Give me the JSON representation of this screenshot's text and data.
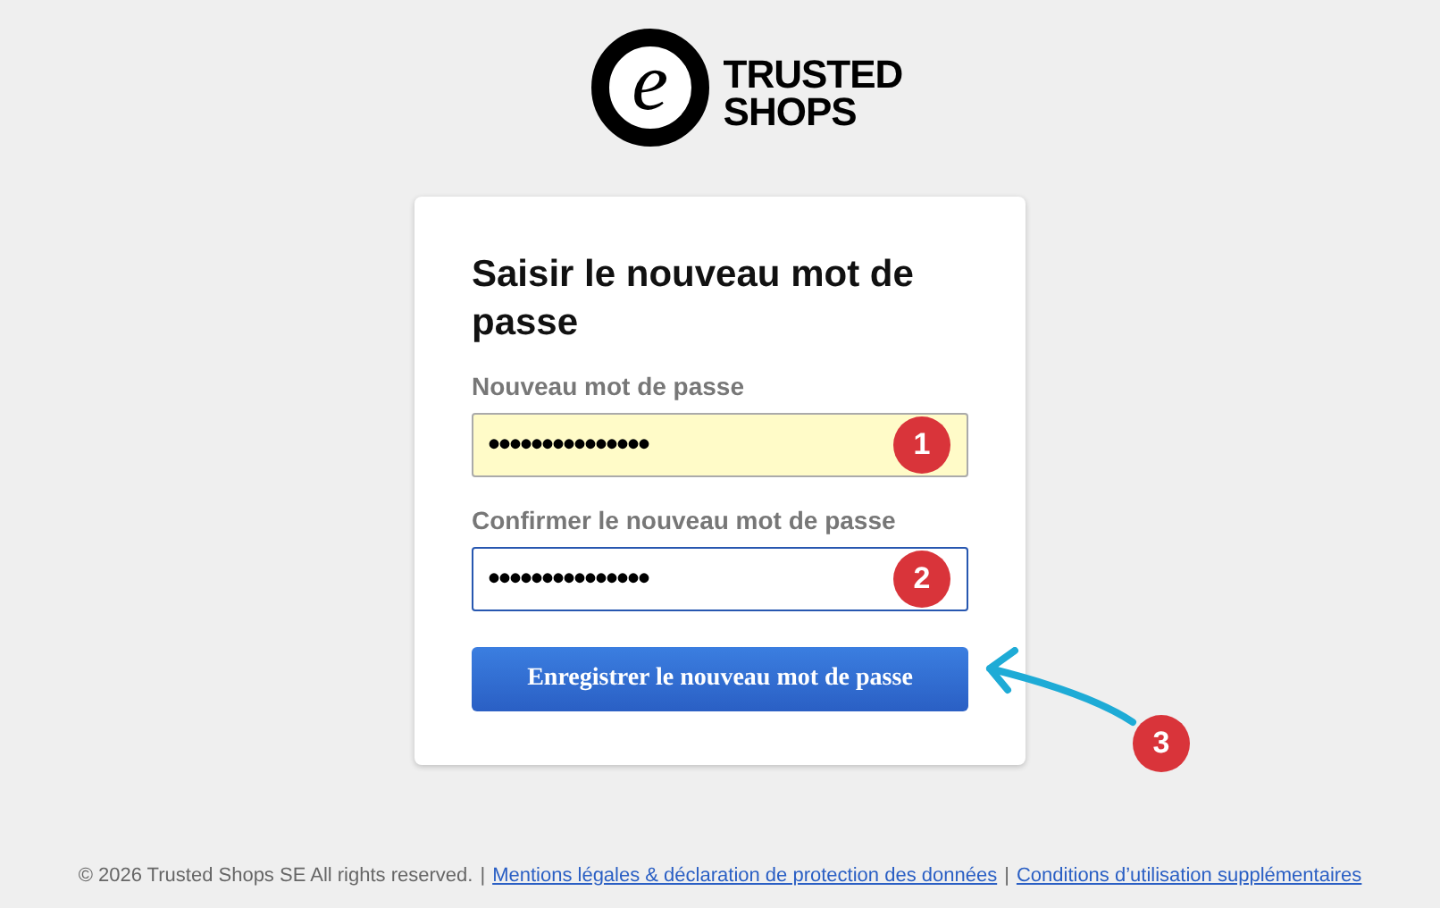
{
  "logo": {
    "mark": "e",
    "line_1": "TRUSTED",
    "line_2": "SHOPS"
  },
  "card": {
    "title": "Saisir le nouveau mot de passe",
    "fields": [
      {
        "label": "Nouveau mot de passe",
        "value": "•••••••••••••••",
        "autofilled": true,
        "focused": false,
        "marker": "1"
      },
      {
        "label": "Confirmer le nouveau mot de passe",
        "value": "•••••••••••••••",
        "autofilled": false,
        "focused": true,
        "marker": "2"
      }
    ],
    "button": {
      "label": "Enregistrer le nouveau mot de passe",
      "marker": "3"
    }
  },
  "footer": {
    "copyright": "© 2026 Trusted Shops SE All rights reserved.",
    "separator_1": "|",
    "link_1": "Mentions légales & déclaration de protection des données",
    "separator_2": "|",
    "link_2": "Conditions d’utilisation supplémentaires"
  }
}
